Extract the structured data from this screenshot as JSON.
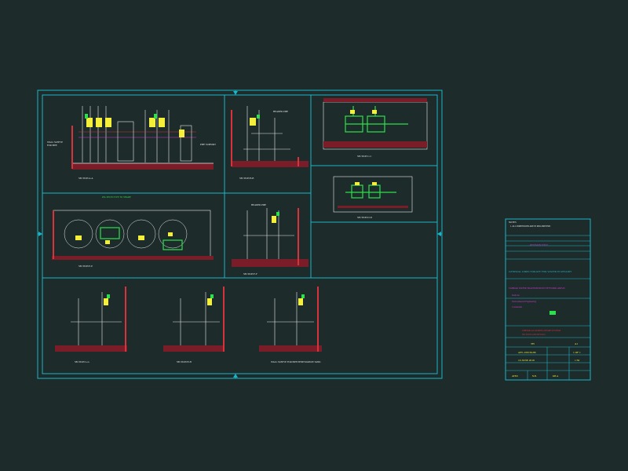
{
  "drawing": {
    "views": {
      "plan_title": "PIG SELECTIVE TO SHARE",
      "section_labels": [
        "SECTION A-A",
        "SECTION B-B",
        "SECTION C-C",
        "SECTION D-D",
        "SECTION E-E",
        "SECTION F-F",
        "SECTION G-G",
        "SECTION H-H"
      ],
      "note_label": "WALL SLEEVE FOR PIPE PENETRATION TANK",
      "callout_label": "HEADER PIPE"
    }
  },
  "title_block": {
    "notes_heading": "NOTES",
    "note_1": "1. ALL DIMENSIONS ARE IN MILLIMETERS",
    "revision_heading": "REVISION TITLE",
    "client": "GENERAL DIRECTORATE FOR WATER IN RIYADH",
    "project": "TABRAK WATER TRANSMISSION NETWORK AREAS",
    "consultant_line1": "DAR AL",
    "consultant_line2": "Environmental Engineering",
    "consultant_line3": "Consultants",
    "drawing_title_1": "CHEMICAL DOSING PUMP SYSTEM",
    "drawing_title_2": "SECTIONS AND DETAILS",
    "drawing_no": "TH",
    "size": "A1",
    "code": "AFL-1001M-86",
    "sheet": "1 OF 1",
    "date": "10 JUNE 2018",
    "scale": "1:50",
    "designed": "ATED",
    "checked": "N.B.",
    "approved": "KH.A"
  },
  "colors": {
    "background": "#1e2b2b",
    "frame": "#19b6c8",
    "green": "#2be04a",
    "yellow": "#f3ef3a",
    "red": "#d8323c",
    "white": "#e9e9e9",
    "magenta": "#d23ad2",
    "floor": "#7a1d28"
  }
}
